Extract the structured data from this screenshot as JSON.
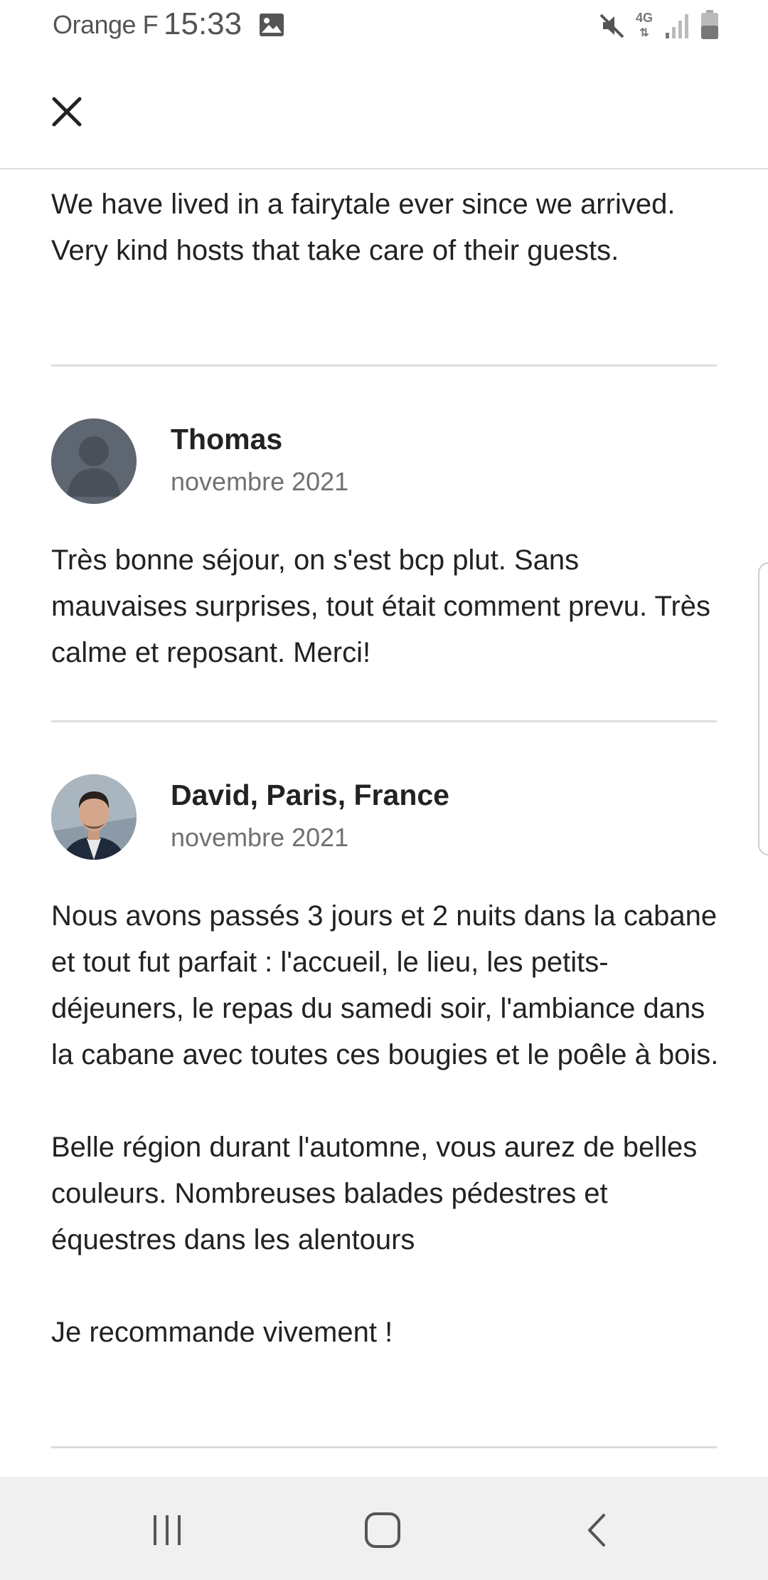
{
  "status_bar": {
    "carrier": "Orange F",
    "time": "15:33",
    "network": "4G"
  },
  "header": {
    "close_icon": "close-icon"
  },
  "reviews": [
    {
      "text": "We have lived in a fairytale ever since we arrived. Very kind hosts that take care of their guests."
    },
    {
      "name": "Thomas",
      "date": "novembre 2021",
      "avatar": "default-avatar",
      "text": "Très bonne séjour, on s'est bcp plut. Sans mauvaises surprises, tout était comment prevu. Très calme et reposant. Merci!"
    },
    {
      "name": "David, Paris, France",
      "date": "novembre 2021",
      "avatar": "photo-avatar",
      "text": "Nous avons passés 3 jours et 2 nuits dans la cabane et tout fut parfait : l'accueil, le lieu, les petits-déjeuners, le repas du samedi soir, l'ambiance dans la cabane avec toutes ces bougies et le poêle à bois.\n\nBelle région durant l'automne, vous aurez de belles couleurs. Nombreuses balades pédestres et équestres dans les alentours\n\nJe recommande vivement !"
    }
  ],
  "nav_bar": {
    "recents_icon": "recents-icon",
    "home_icon": "home-icon",
    "back_icon": "back-icon"
  },
  "colors": {
    "text": "#222222",
    "muted": "#717171",
    "divider": "#dddddd",
    "nav_bg": "#f0f0f0"
  }
}
